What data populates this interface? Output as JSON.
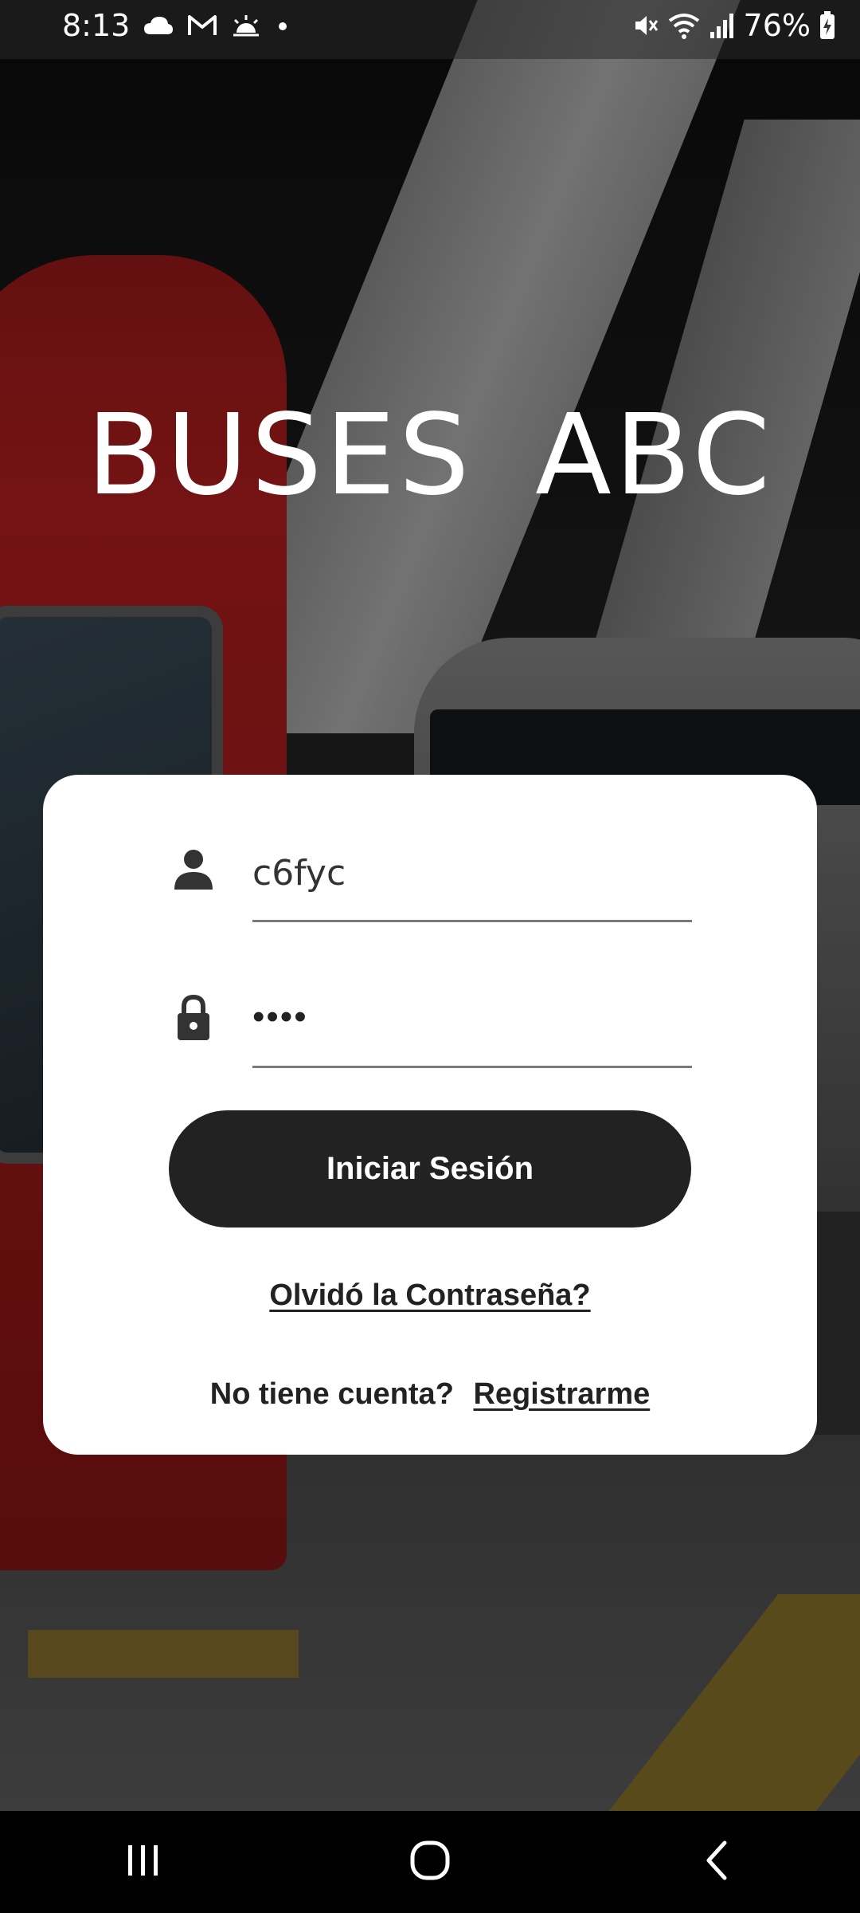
{
  "status_bar": {
    "time": "8:13",
    "battery": "76%",
    "left_icons": [
      "cloud-icon",
      "gmail-icon",
      "sunrise-icon",
      "dot-icon"
    ],
    "right_icons": [
      "mute-icon",
      "wifi-icon",
      "signal-icon",
      "battery-charging-icon"
    ]
  },
  "app": {
    "title": "BUSES ABC"
  },
  "login": {
    "username_value": "c6fyc",
    "password_mask": "••••",
    "login_button": "Iniciar Sesión",
    "forgot_link": "Olvidó la Contraseña?",
    "no_account_text": "No tiene cuenta?",
    "register_link": "Registrarme"
  },
  "colors": {
    "button_bg": "#222222",
    "card_bg": "#ffffff",
    "text_dark": "#222222"
  },
  "nav_bar": {
    "buttons": [
      "recent-apps-icon",
      "home-icon",
      "back-icon"
    ]
  }
}
